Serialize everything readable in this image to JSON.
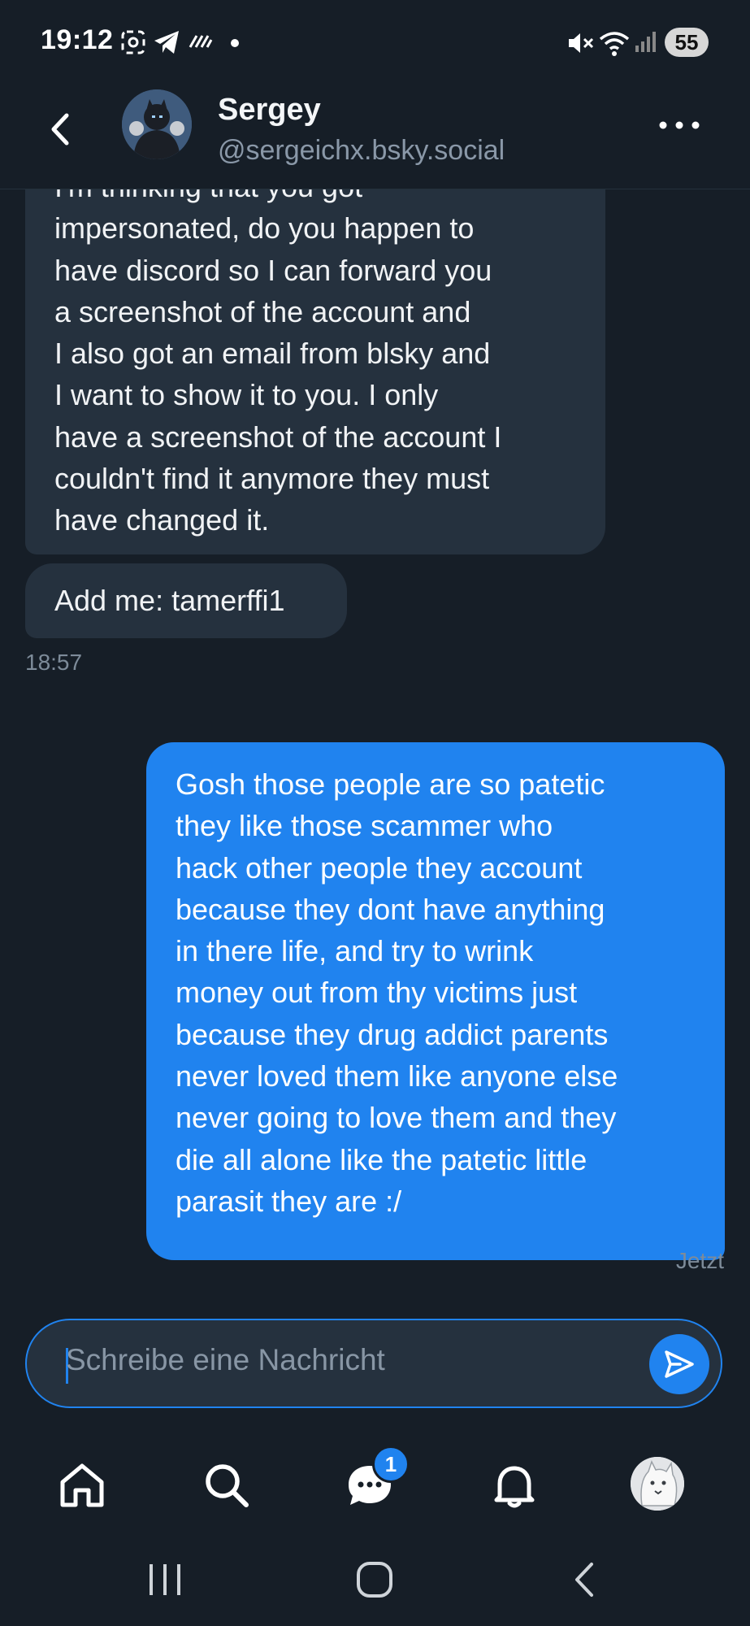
{
  "status_bar": {
    "time": "19:12",
    "battery": "55"
  },
  "header": {
    "name": "Sergey",
    "handle": "@sergeichx.bsky.social"
  },
  "messages": [
    {
      "direction": "incoming",
      "text": "I'm thinking that you got\nimpersonated, do you happen to\nhave discord so I can forward you\na screenshot of the account and\nI also got an email from blsky and\nI want to show it to you. I only\nhave a screenshot of the account I\ncouldn't find it anymore they must\nhave changed it."
    },
    {
      "direction": "incoming",
      "text": "Add me: tamerffi1"
    },
    {
      "direction": "outgoing",
      "text": "Gosh those people are so patetic\nthey like those scammer who\nhack other people they account\nbecause they dont have anything\nin there life, and try to wrink\nmoney out from thy victims just\nbecause they drug addict parents\nnever loved them like anyone else\nnever going to love them and they\ndie all alone like the patetic little\nparasit they are :/"
    }
  ],
  "timestamps": {
    "incoming": "18:57",
    "outgoing": "Jetzt"
  },
  "composer": {
    "placeholder": "Schreibe eine Nachricht"
  },
  "bottom_nav": {
    "chat_badge": "1"
  },
  "colors": {
    "background": "#161e27",
    "bubble_incoming": "#25313e",
    "accent": "#2083ef"
  }
}
